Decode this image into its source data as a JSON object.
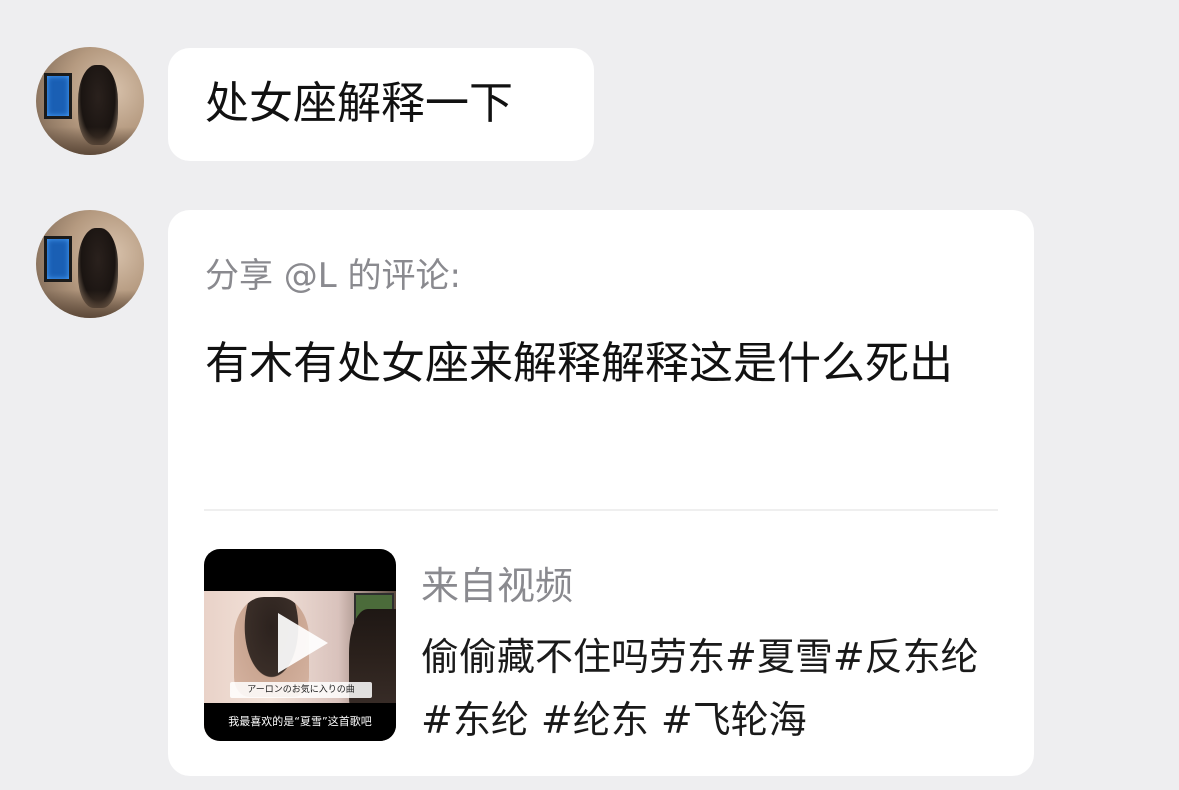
{
  "messages": [
    {
      "type": "text",
      "text": "处女座解释一下"
    },
    {
      "type": "shared_comment",
      "header": "分享 @L 的评论:",
      "comment": "有木有处女座来解释解释这是什么死出",
      "source_label": "来自视频",
      "video": {
        "title": "偷偷藏不住吗劳东#夏雪#反东纶 #东纶 #纶东 #飞轮海",
        "thumbnail_overlay_jp": "アーロンのお気に入りの曲",
        "thumbnail_subtitle": "我最喜欢的是“夏雪”这首歌吧",
        "play_icon": "play-icon"
      }
    }
  ],
  "colors": {
    "background": "#eeeef0",
    "bubble": "#ffffff",
    "primary_text": "#111111",
    "secondary_text": "#8a8a8f"
  }
}
